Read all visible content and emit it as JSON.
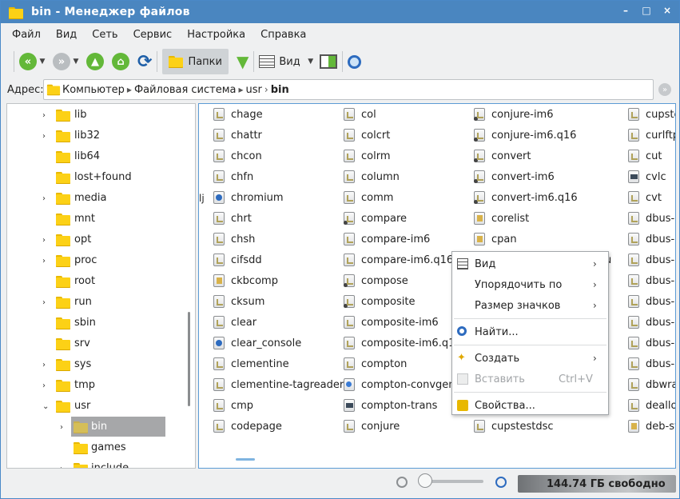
{
  "window": {
    "title": "bin - Менеджер файлов",
    "controls": [
      "–",
      "□",
      "×"
    ]
  },
  "menu": [
    "Файл",
    "Вид",
    "Сеть",
    "Сервис",
    "Настройка",
    "Справка"
  ],
  "toolbar": {
    "folders_label": "Папки",
    "view_label": "Вид"
  },
  "address": {
    "label": "Адрес:",
    "crumbs": [
      "Компьютер",
      "Файловая система",
      "usr",
      "bin"
    ]
  },
  "tree": {
    "items": [
      "lib",
      "lib32",
      "lib64",
      "lost+found",
      "media",
      "mnt",
      "opt",
      "proc",
      "root",
      "run",
      "sbin",
      "srv",
      "sys",
      "tmp",
      "usr",
      "bin",
      "games",
      "include"
    ]
  },
  "files": {
    "col1": [
      "chage",
      "chattr",
      "chcon",
      "chfn",
      "chromium",
      "chrt",
      "chsh",
      "cifsdd",
      "ckbcomp",
      "cksum",
      "clear",
      "clear_console",
      "clementine",
      "clementine-tagreader",
      "cmp",
      "codepage"
    ],
    "col2": [
      "col",
      "colcrt",
      "colrm",
      "column",
      "comm",
      "compare",
      "compare-im6",
      "compare-im6.q16",
      "compose",
      "composite",
      "composite-im6",
      "composite-im6.q16",
      "compton",
      "compton-convgen.",
      "compton-trans",
      "conjure"
    ],
    "col3": [
      "conjure-im6",
      "conjure-im6.q16",
      "convert",
      "convert-im6",
      "convert-im6.q16",
      "corelist",
      "cpan",
      "",
      "",
      "",
      "",
      "",
      "",
      "",
      "",
      "cupstestdsc"
    ],
    "col3_partial": "u",
    "col4": [
      "cupste",
      "curlftp",
      "cut",
      "cvlc",
      "cvt",
      "dbus-c",
      "dbus-c",
      "dbus-l",
      "dbus-r",
      "dbus-r",
      "dbus-s",
      "dbus-u",
      "dbus-u",
      "dbwra",
      "deallo",
      "deb-sy"
    ],
    "left_partial": "lj"
  },
  "context_menu": {
    "view": "Вид",
    "sort_by": "Упорядочить по",
    "icon_size": "Размер значков",
    "find": "Найти...",
    "create": "Создать",
    "paste": "Вставить",
    "paste_shortcut": "Ctrl+V",
    "properties": "Свойства..."
  },
  "status": {
    "free_space": "144.74 ГБ свободно"
  }
}
